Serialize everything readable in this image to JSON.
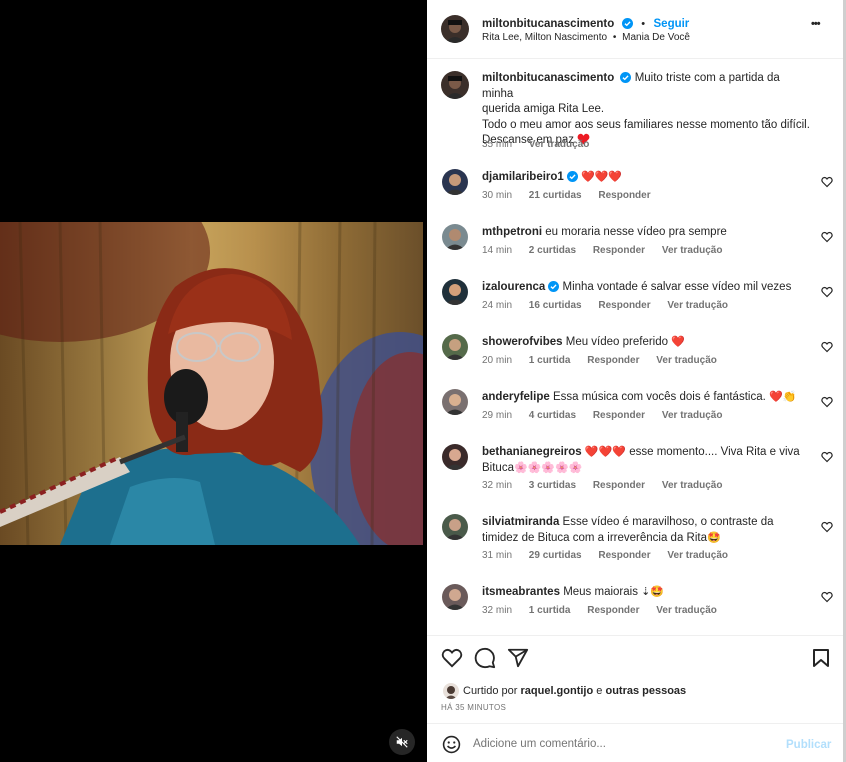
{
  "post": {
    "username": "miltonbitucanascimento",
    "dot": "•",
    "follow_label": "Seguir",
    "audio": "Rita Lee, Milton Nascimento",
    "audio_sep": "•",
    "song": "Mania De Você",
    "more_label": "•••"
  },
  "caption": {
    "username": "miltonbitucanascimento",
    "line1": "Muito triste com a partida da minha",
    "line2": "querida amiga Rita Lee.",
    "line3": "Todo o meu amor aos seus familiares nesse momento tão difícil.",
    "line4": "Descanse em paz",
    "time": "35 min",
    "translate": "Ver tradução"
  },
  "comments": [
    {
      "user": "djamilaribeiro1",
      "verified": true,
      "text": "",
      "emoji": "❤️❤️❤️",
      "time": "30 min",
      "likes": "21 curtidas",
      "reply": "Responder",
      "translate": ""
    },
    {
      "user": "mthpetroni",
      "verified": false,
      "text": "eu moraria nesse vídeo pra sempre",
      "time": "14 min",
      "likes": "2 curtidas",
      "reply": "Responder",
      "translate": "Ver tradução"
    },
    {
      "user": "izalourenca",
      "verified": true,
      "text": "Minha vontade é salvar esse vídeo mil vezes",
      "time": "24 min",
      "likes": "16 curtidas",
      "reply": "Responder",
      "translate": "Ver tradução"
    },
    {
      "user": "showerofvibes",
      "verified": false,
      "text": "Meu vídeo preferido",
      "emoji": "❤️",
      "time": "20 min",
      "likes": "1 curtida",
      "reply": "Responder",
      "translate": "Ver tradução"
    },
    {
      "user": "anderyfelipe",
      "verified": false,
      "text": "Essa música com vocês dois é fantástica.",
      "emoji": "❤️👏",
      "time": "29 min",
      "likes": "4 curtidas",
      "reply": "Responder",
      "translate": "Ver tradução"
    },
    {
      "user": "bethanianegreiros",
      "verified": false,
      "text": "esse momento.... Viva Rita e viva",
      "pre_emoji": "❤️❤️❤️",
      "line2": "Bituca",
      "line2_emoji": "🌸🌸🌸🌸🌸",
      "time": "32 min",
      "likes": "3 curtidas",
      "reply": "Responder",
      "translate": "Ver tradução"
    },
    {
      "user": "silviatmiranda",
      "verified": false,
      "text": "Esse vídeo é maravilhoso, o contraste da",
      "line2": "timidez de Bituca com a irreverência da Rita",
      "line2_emoji": "🤩",
      "time": "31 min",
      "likes": "29 curtidas",
      "reply": "Responder",
      "translate": "Ver tradução"
    },
    {
      "user": "itsmeabrantes",
      "verified": false,
      "text": "Meus maiorais",
      "emoji": "⇣🤩",
      "time": "32 min",
      "likes": "1 curtida",
      "reply": "Responder",
      "translate": "Ver tradução"
    }
  ],
  "likes_bar": {
    "liked_by_prefix": "Curtido por",
    "liked_by_user": "raquel.gontijo",
    "liked_by_and": "e",
    "liked_by_others": "outras pessoas",
    "timestamp": "HÁ 35 MINUTOS"
  },
  "composer": {
    "placeholder": "Adicione um comentário...",
    "publish": "Publicar"
  },
  "colors": {
    "accent": "#0095f6",
    "verified": "#0095f6",
    "heart": "#ed1b24"
  }
}
